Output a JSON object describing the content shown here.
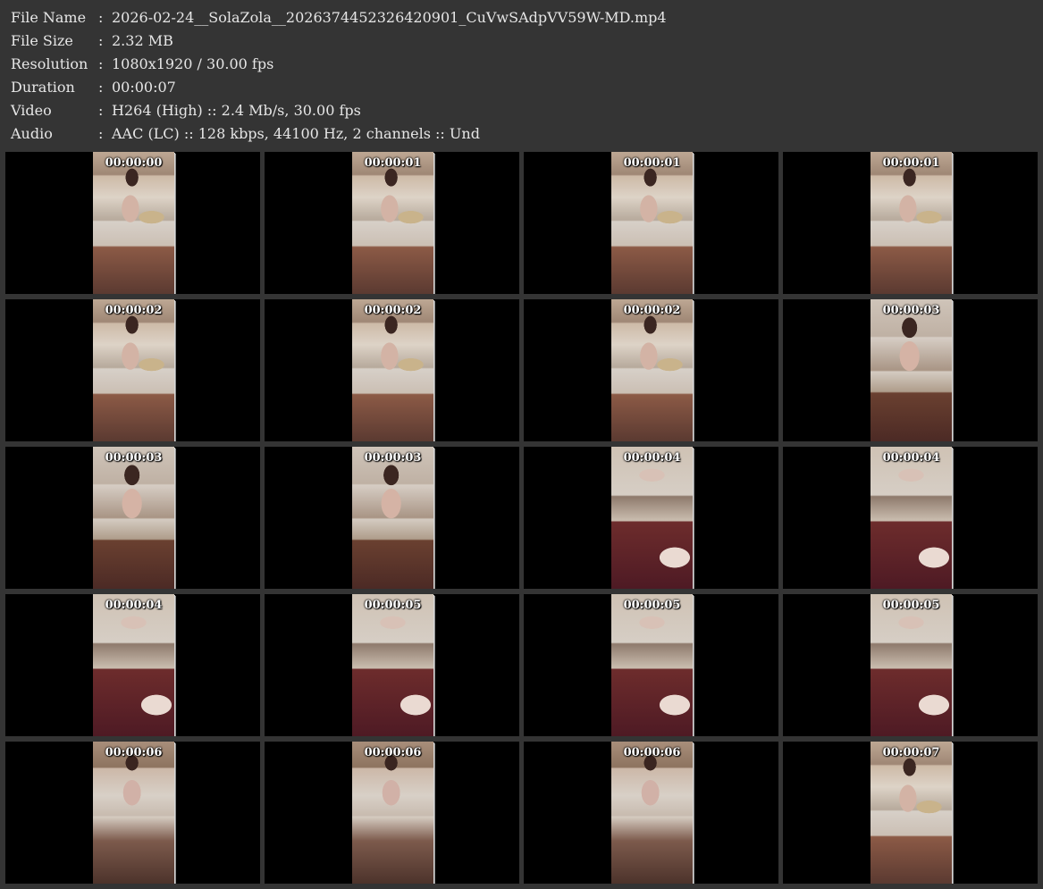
{
  "metadata": [
    {
      "label": "File Name",
      "value": "2026-02-24__SolaZola__2026374452326420901_CuVwSAdpVV59W-MD.mp4"
    },
    {
      "label": "File Size",
      "value": "2.32 MB"
    },
    {
      "label": "Resolution",
      "value": "1080x1920 / 30.00 fps"
    },
    {
      "label": "Duration",
      "value": "00:00:07"
    },
    {
      "label": "Video",
      "value": "H264 (High) :: 2.4 Mb/s, 30.00 fps"
    },
    {
      "label": "Audio",
      "value": "AAC (LC) :: 128 kbps, 44100 Hz, 2 channels :: Und"
    }
  ],
  "separator": ":",
  "thumbnails": [
    "00:00:00",
    "00:00:01",
    "00:00:01",
    "00:00:01",
    "00:00:02",
    "00:00:02",
    "00:00:02",
    "00:00:03",
    "00:00:03",
    "00:00:03",
    "00:00:04",
    "00:00:04",
    "00:00:04",
    "00:00:05",
    "00:00:05",
    "00:00:05",
    "00:00:06",
    "00:00:06",
    "00:00:06",
    "00:00:07"
  ]
}
